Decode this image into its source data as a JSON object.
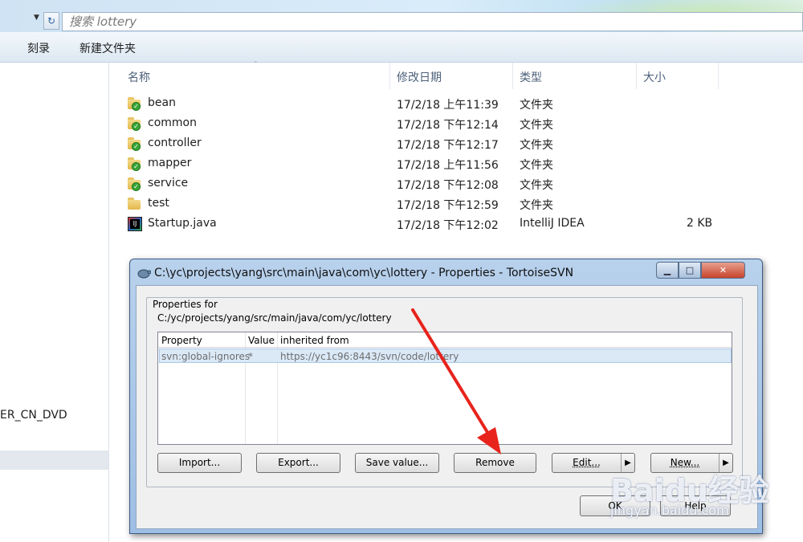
{
  "address_bar": {
    "search_placeholder": "搜索 lottery",
    "dropdown_glyph": "▼",
    "refresh_glyph": "↻"
  },
  "toolbar": {
    "burn_label": "刻录",
    "new_folder_label": "新建文件夹"
  },
  "nav_pane": {
    "drive_label": "ER_CN_DVD"
  },
  "file_list": {
    "columns": [
      "名称",
      "修改日期",
      "类型",
      "大小"
    ],
    "rows": [
      {
        "name": "bean",
        "date": "17/2/18 上午11:39",
        "type": "文件夹",
        "size": "",
        "icon": "svn-folder-icon"
      },
      {
        "name": "common",
        "date": "17/2/18 下午12:14",
        "type": "文件夹",
        "size": "",
        "icon": "svn-folder-icon"
      },
      {
        "name": "controller",
        "date": "17/2/18 下午12:17",
        "type": "文件夹",
        "size": "",
        "icon": "svn-folder-icon"
      },
      {
        "name": "mapper",
        "date": "17/2/18 上午11:56",
        "type": "文件夹",
        "size": "",
        "icon": "svn-folder-icon"
      },
      {
        "name": "service",
        "date": "17/2/18 下午12:08",
        "type": "文件夹",
        "size": "",
        "icon": "svn-folder-icon"
      },
      {
        "name": "test",
        "date": "17/2/18 下午12:59",
        "type": "文件夹",
        "size": "",
        "icon": "folder-icon"
      },
      {
        "name": "Startup.java",
        "date": "17/2/18 下午12:02",
        "type": "IntelliJ IDEA",
        "size": "2 KB",
        "icon": "java-file-icon"
      }
    ]
  },
  "dialog": {
    "title": "C:\\yc\\projects\\yang\\src\\main\\java\\com\\yc\\lottery - Properties - TortoiseSVN",
    "group_label": "Properties for",
    "path": "C:/yc/projects/yang/src/main/java/com/yc/lottery",
    "list_columns": [
      "Property",
      "Value",
      "inherited from"
    ],
    "properties": [
      {
        "property": "svn:global-ignores",
        "value": "*",
        "inherited_from": "https://yc1c96:8443/svn/code/lottery"
      }
    ],
    "buttons": {
      "import": "Import...",
      "export": "Export...",
      "save_value": "Save value...",
      "remove": "Remove",
      "edit": "Edit...",
      "new": "New..."
    },
    "ok": "OK",
    "help": "Help",
    "caption": {
      "minimize": "▁",
      "maximize": "□",
      "close": "✕"
    }
  },
  "watermark": {
    "brand": "Baidu经验",
    "url": "jingyan.baidu.com"
  },
  "colors": {
    "annotation_arrow": "#e8231c",
    "dialog_frame": "#a8c6e8",
    "selection": "#dbe9f7"
  }
}
